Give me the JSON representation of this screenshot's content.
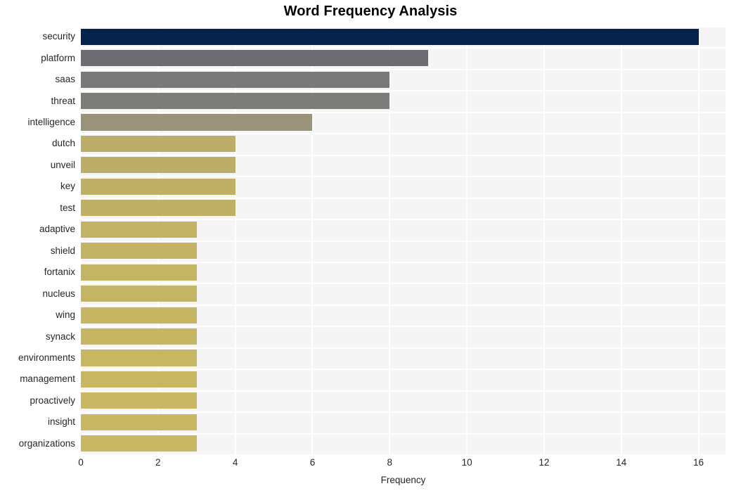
{
  "chart_data": {
    "type": "bar",
    "orientation": "horizontal",
    "title": "Word Frequency Analysis",
    "xlabel": "Frequency",
    "ylabel": "",
    "xlim": [
      0,
      16.7
    ],
    "xticks": [
      0,
      2,
      4,
      6,
      8,
      10,
      12,
      14,
      16
    ],
    "xtick_labels": [
      "0",
      "2",
      "4",
      "6",
      "8",
      "10",
      "12",
      "14",
      "16"
    ],
    "grid": true,
    "legend": "none",
    "categories": [
      "security",
      "platform",
      "saas",
      "threat",
      "intelligence",
      "dutch",
      "unveil",
      "key",
      "test",
      "adaptive",
      "shield",
      "fortanix",
      "nucleus",
      "wing",
      "synack",
      "environments",
      "management",
      "proactively",
      "insight",
      "organizations"
    ],
    "values": [
      16,
      9,
      8,
      8,
      6,
      4,
      4,
      4,
      4,
      3,
      3,
      3,
      3,
      3,
      3,
      3,
      3,
      3,
      3,
      3
    ],
    "bar_colors": [
      "#04224c",
      "#6b6d72",
      "#797a77",
      "#7c7c78",
      "#9a9379",
      "#bcae68",
      "#bcae68",
      "#bfb066",
      "#bfb066",
      "#c2b365",
      "#c2b365",
      "#c4b564",
      "#c4b564",
      "#c6b664",
      "#c6b664",
      "#c7b763",
      "#c7b763",
      "#c9b863",
      "#c9b863",
      "#c9b863"
    ],
    "plot_background": "#f5f5f5",
    "grid_color": "#ffffff",
    "figure_background": "#ffffff",
    "tick_label_color": "#262626"
  }
}
